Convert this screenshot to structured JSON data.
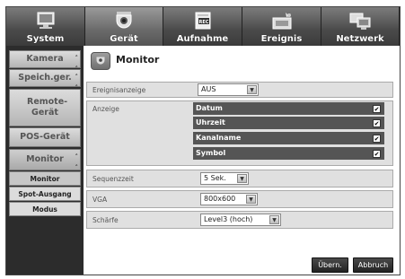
{
  "tabs": [
    {
      "label": "System",
      "icon": "monitor-icon",
      "active": false
    },
    {
      "label": "Gerät",
      "icon": "camera-icon",
      "active": true
    },
    {
      "label": "Aufnahme",
      "icon": "rec-icon",
      "active": false
    },
    {
      "label": "Ereignis",
      "icon": "event-icon",
      "active": false
    },
    {
      "label": "Netzwerk",
      "icon": "network-icon",
      "active": false
    }
  ],
  "menu": {
    "kamera": "Kamera",
    "speicher": "Speich.ger.",
    "remote": "Remote-Gerät",
    "pos": "POS-Gerät",
    "monitor": "Monitor",
    "sub": [
      "Monitor",
      "Spot-Ausgang",
      "Modus"
    ]
  },
  "page": {
    "title": "Monitor"
  },
  "ereignisanzeige": {
    "label": "Ereignisanzeige",
    "value": "AUS"
  },
  "anzeige": {
    "label": "Anzeige",
    "options": [
      {
        "label": "Datum",
        "checked": true
      },
      {
        "label": "Uhrzeit",
        "checked": true
      },
      {
        "label": "Kanalname",
        "checked": true
      },
      {
        "label": "Symbol",
        "checked": true
      }
    ]
  },
  "sequenzzeit": {
    "label": "Sequenzzeit",
    "value": "5 Sek."
  },
  "vga": {
    "label": "VGA",
    "value": "800x600"
  },
  "schaerfe": {
    "label": "Schärfe",
    "value": "Level3 (hoch)"
  },
  "buttons": {
    "apply": "Übern.",
    "cancel": "Abbruch"
  },
  "colors": {
    "accent": "#555555",
    "background": "#2b2b2b"
  }
}
